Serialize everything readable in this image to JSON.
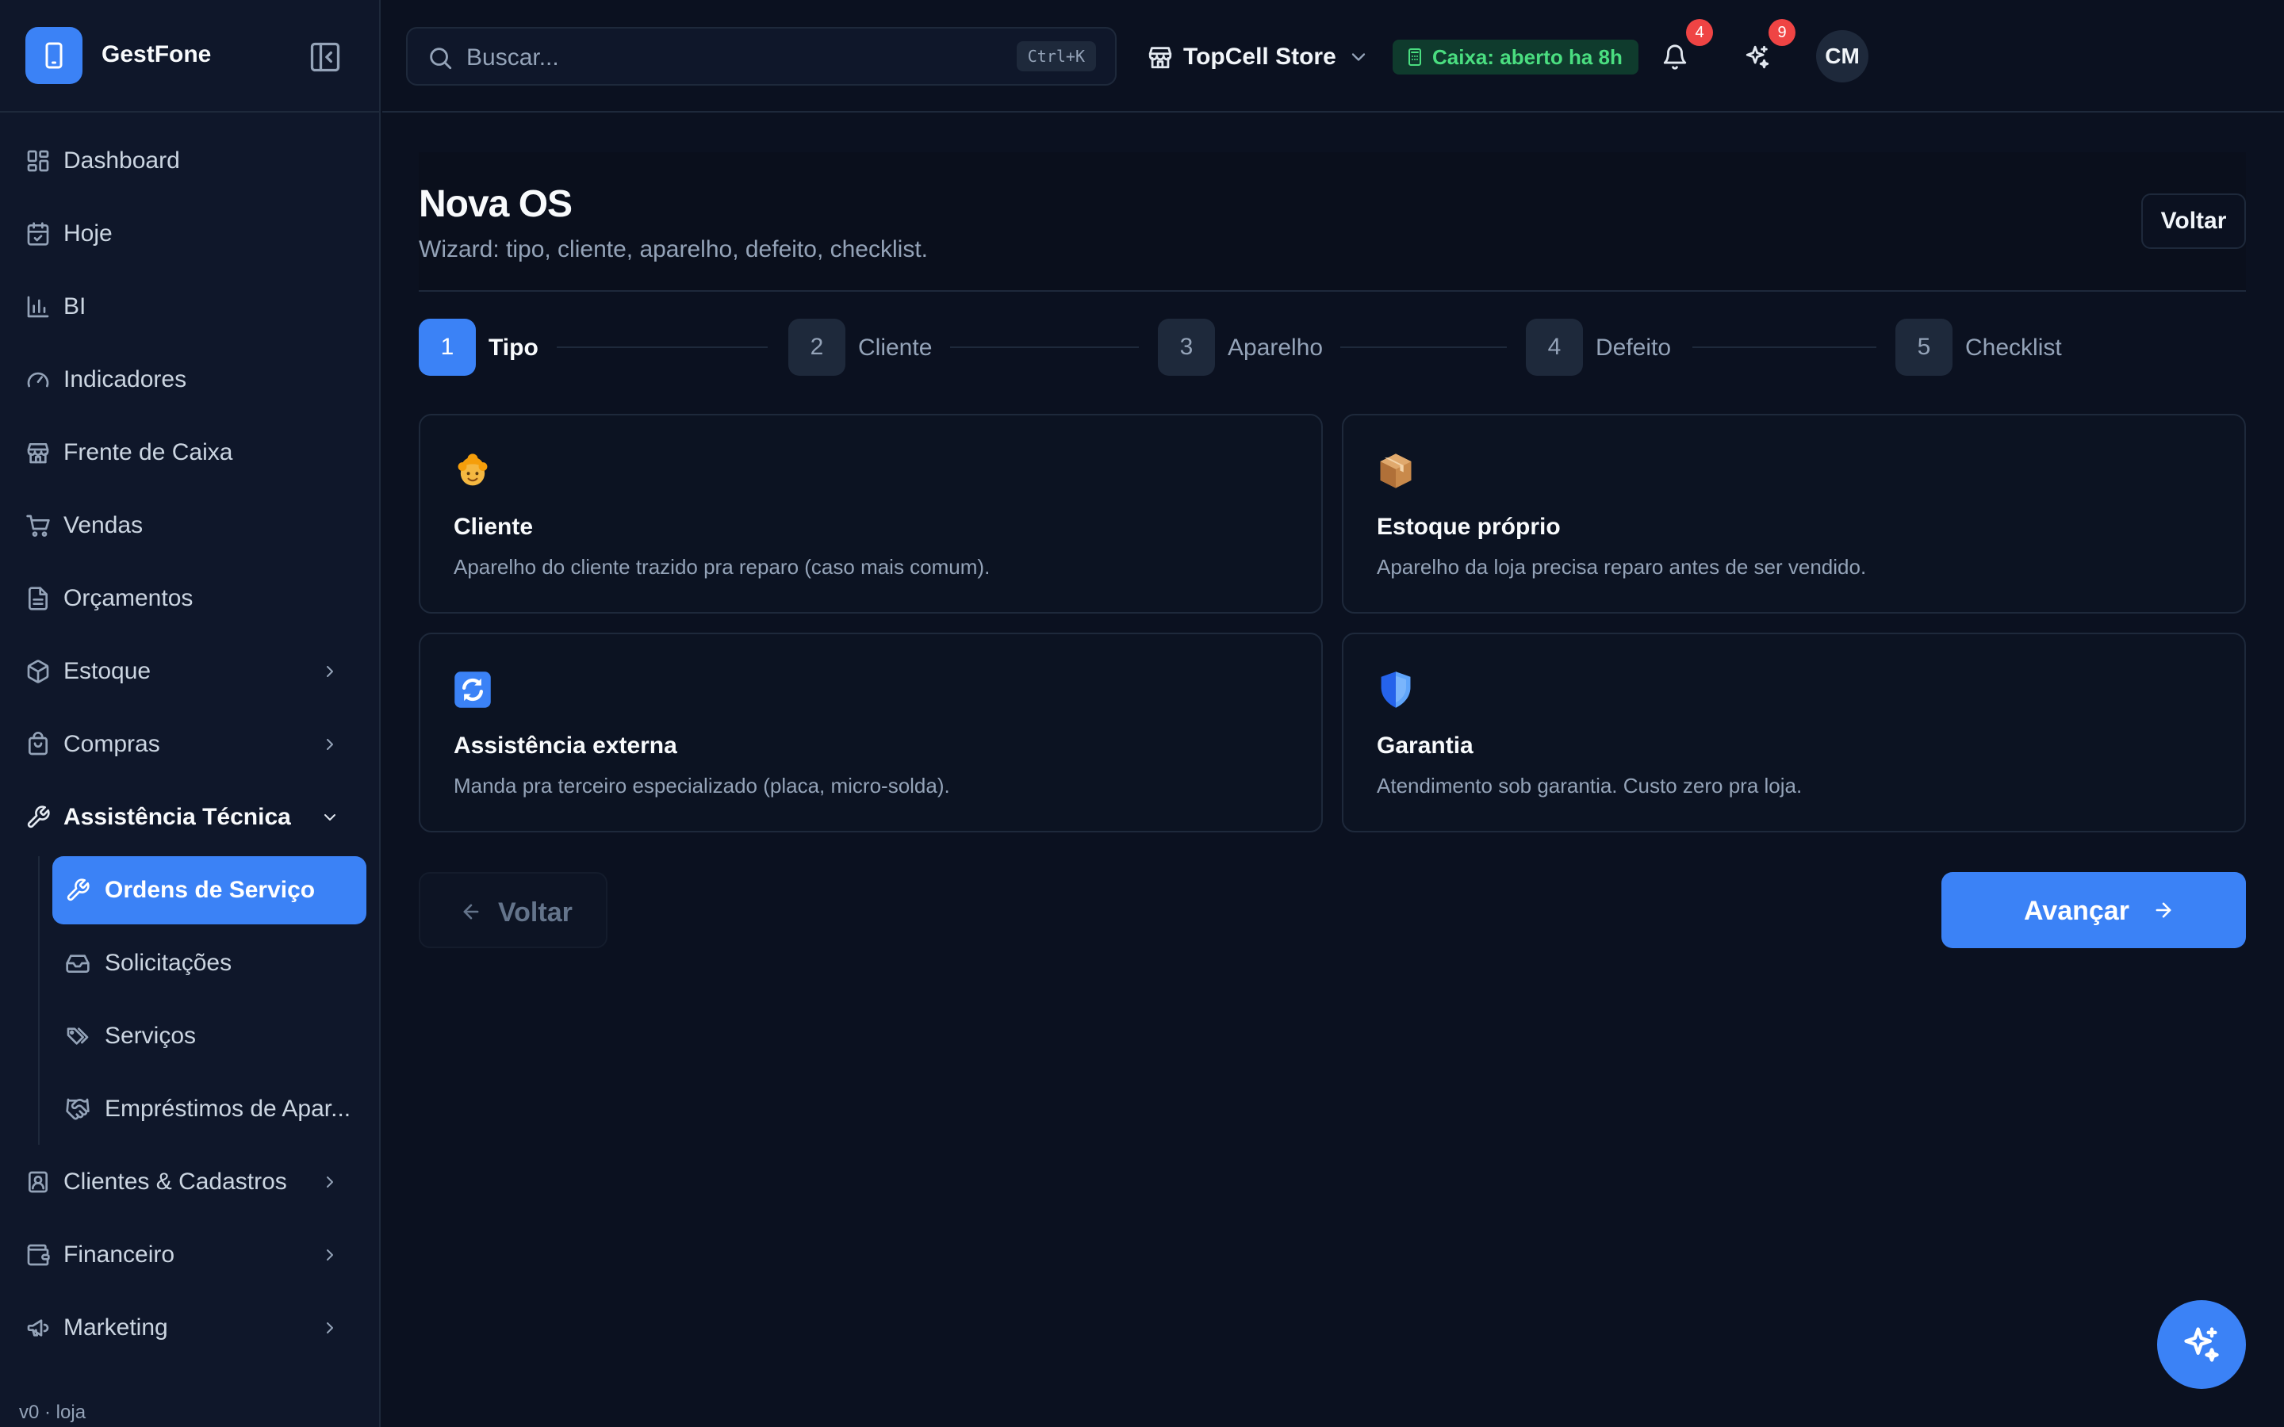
{
  "brand": {
    "name": "GestFone"
  },
  "sidebar": {
    "items": [
      {
        "label": "Dashboard",
        "icon": "dashboard-icon"
      },
      {
        "label": "Hoje",
        "icon": "calendar-icon"
      },
      {
        "label": "BI",
        "icon": "bar-chart-icon"
      },
      {
        "label": "Indicadores",
        "icon": "gauge-icon"
      },
      {
        "label": "Frente de Caixa",
        "icon": "store-icon"
      },
      {
        "label": "Vendas",
        "icon": "cart-icon"
      },
      {
        "label": "Orçamentos",
        "icon": "document-icon"
      },
      {
        "label": "Estoque",
        "icon": "package-icon"
      },
      {
        "label": "Compras",
        "icon": "shopping-bag-icon"
      },
      {
        "label": "Assistência Técnica",
        "icon": "wrench-icon"
      },
      {
        "label": "Clientes & Cadastros",
        "icon": "contact-icon"
      },
      {
        "label": "Financeiro",
        "icon": "wallet-icon"
      },
      {
        "label": "Marketing",
        "icon": "megaphone-icon"
      }
    ],
    "subitems": [
      {
        "label": "Ordens de Serviço",
        "icon": "wrench-icon",
        "active": true
      },
      {
        "label": "Solicitações",
        "icon": "inbox-icon"
      },
      {
        "label": "Serviços",
        "icon": "tags-icon"
      },
      {
        "label": "Empréstimos de Apar...",
        "icon": "handshake-icon"
      }
    ],
    "version": "v0 · loja"
  },
  "topbar": {
    "search_placeholder": "Buscar...",
    "search_shortcut": "Ctrl+K",
    "store_name": "TopCell Store",
    "caixa_status": "Caixa: aberto ha 8h",
    "notifications_count": "4",
    "ai_count": "9",
    "avatar_initials": "CM"
  },
  "page": {
    "title": "Nova OS",
    "subtitle": "Wizard: tipo, cliente, aparelho, defeito, checklist.",
    "back_label": "Voltar"
  },
  "steps": [
    {
      "num": "1",
      "label": "Tipo",
      "active": true
    },
    {
      "num": "2",
      "label": "Cliente"
    },
    {
      "num": "3",
      "label": "Aparelho"
    },
    {
      "num": "4",
      "label": "Defeito"
    },
    {
      "num": "5",
      "label": "Checklist"
    }
  ],
  "options": [
    {
      "title": "Cliente",
      "desc": "Aparelho do cliente trazido pra reparo (caso mais comum).",
      "icon": "person-emoji-icon"
    },
    {
      "title": "Estoque próprio",
      "desc": "Aparelho da loja precisa reparo antes de ser vendido.",
      "icon": "package-emoji-icon"
    },
    {
      "title": "Assistência externa",
      "desc": "Manda pra terceiro especializado (placa, micro-solda).",
      "icon": "cycle-emoji-icon"
    },
    {
      "title": "Garantia",
      "desc": "Atendimento sob garantia. Custo zero pra loja.",
      "icon": "shield-emoji-icon"
    }
  ],
  "footer": {
    "back_label": "Voltar",
    "next_label": "Avançar"
  },
  "colors": {
    "accent": "#3b82f6",
    "background": "#0b1120",
    "sidebar": "#0f172a",
    "success": "#4ade80",
    "danger": "#ef4444"
  }
}
